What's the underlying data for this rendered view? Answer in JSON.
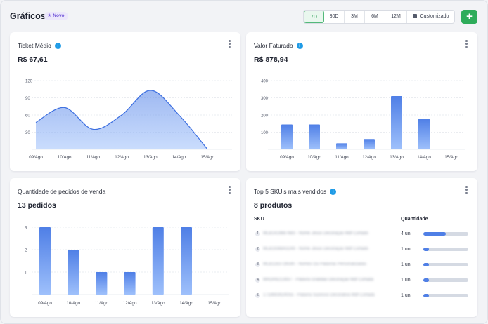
{
  "header": {
    "title": "Gráficos",
    "badge": "Novo",
    "ranges": [
      "7D",
      "30D",
      "3M",
      "6M",
      "12M"
    ],
    "active_range": "7D",
    "custom_label": "Customizado",
    "add_label": "+"
  },
  "cards": {
    "ticket": {
      "title": "Ticket Médio",
      "value": "R$ 67,61",
      "info_icon": "info-icon"
    },
    "revenue": {
      "title": "Valor Faturado",
      "value": "R$ 878,94",
      "info_icon": "info-icon"
    },
    "orders": {
      "title": "Quantidade de pedidos de venda",
      "value": "13 pedidos"
    },
    "top_sku": {
      "title": "Top 5 SKU's mais vendidos",
      "value": "8 produtos",
      "info_icon": "info-icon"
    }
  },
  "top_sku": {
    "col_sku": "SKU",
    "col_qty": "Quantidade",
    "rows": [
      {
        "index": "1",
        "name": "MLB1419887683 - Nome Jesus Decoração Mdf Cortado",
        "qty": "4 un",
        "fraction": 0.5
      },
      {
        "index": "2",
        "name": "MLB1936843249 - Nome Jesus Decoração Mdf Cortado",
        "qty": "1 un",
        "fraction": 0.125
      },
      {
        "index": "3",
        "name": "MLB1163726590 - Nomes Ou Palavras Personalizadas",
        "qty": "1 un",
        "fraction": 0.125
      },
      {
        "index": "4",
        "name": "MRDR6213937 - Palavra Gratidão Decoração Mdf Cortada",
        "qty": "1 un",
        "fraction": 0.125
      },
      {
        "index": "5",
        "name": "1718693924055 - Palavra Sucesso Decorativa Mdf Cortada",
        "qty": "1 un",
        "fraction": 0.125
      }
    ]
  },
  "colors": {
    "accent": "#4f7fe6",
    "green": "#2eac5a",
    "info": "#1f9be6"
  },
  "chart_data": [
    {
      "type": "area",
      "categories": [
        "09/Ago",
        "10/Ago",
        "11/Ago",
        "12/Ago",
        "13/Ago",
        "14/Ago",
        "15/Ago"
      ],
      "values": [
        47,
        73,
        35,
        60,
        103,
        60,
        0
      ],
      "yticks": [
        30,
        60,
        90,
        120
      ],
      "ylim": [
        0,
        120
      ],
      "title": "Ticket Médio",
      "grid": true
    },
    {
      "type": "bar",
      "categories": [
        "09/Ago",
        "10/Ago",
        "11/Ago",
        "12/Ago",
        "13/Ago",
        "14/Ago",
        "15/Ago"
      ],
      "values": [
        145,
        145,
        35,
        60,
        310,
        178,
        0
      ],
      "yticks": [
        100,
        200,
        300,
        400
      ],
      "ylim": [
        0,
        400
      ],
      "title": "Valor Faturado",
      "grid": true
    },
    {
      "type": "bar",
      "categories": [
        "09/Ago",
        "10/Ago",
        "11/Ago",
        "12/Ago",
        "13/Ago",
        "14/Ago",
        "15/Ago"
      ],
      "values": [
        3,
        2,
        1,
        1,
        3,
        3,
        0
      ],
      "yticks": [
        1,
        2,
        3
      ],
      "ylim": [
        0,
        3
      ],
      "title": "Quantidade de pedidos de venda",
      "grid": true
    }
  ]
}
